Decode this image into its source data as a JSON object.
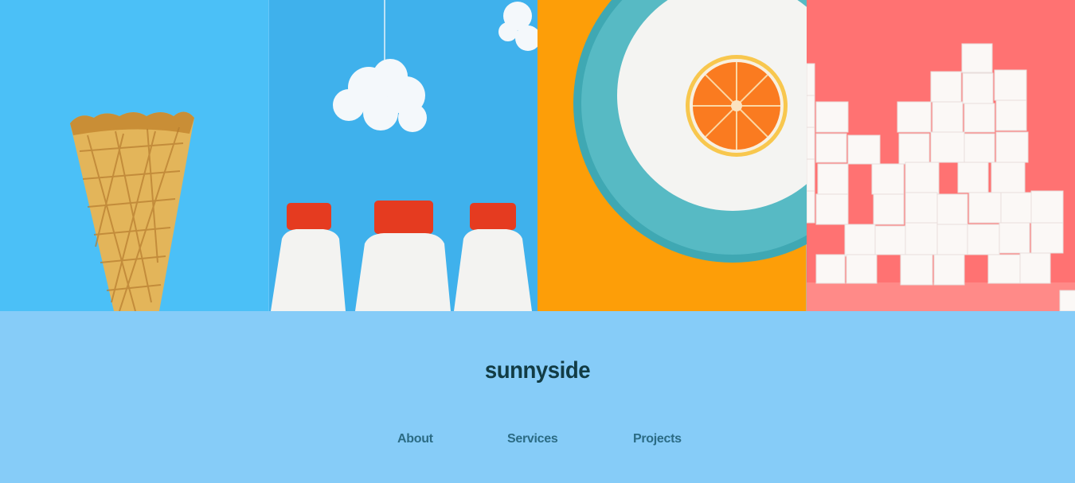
{
  "gallery": {
    "images": [
      {
        "icon": "ice-cream-cone-image",
        "bg": "#4BC0F7"
      },
      {
        "icon": "milk-bottles-image",
        "bg": "#3FB1EC"
      },
      {
        "icon": "orange-on-plate-image",
        "bg": "#FD9E08"
      },
      {
        "icon": "sugar-cubes-image",
        "bg": "#FF7272"
      }
    ]
  },
  "footer": {
    "logo": "sunnyside",
    "nav": {
      "about": "About",
      "services": "Services",
      "projects": "Projects"
    },
    "colors": {
      "background": "#86CCF8",
      "logo": "#123C45",
      "links": "#2B6B84"
    }
  }
}
